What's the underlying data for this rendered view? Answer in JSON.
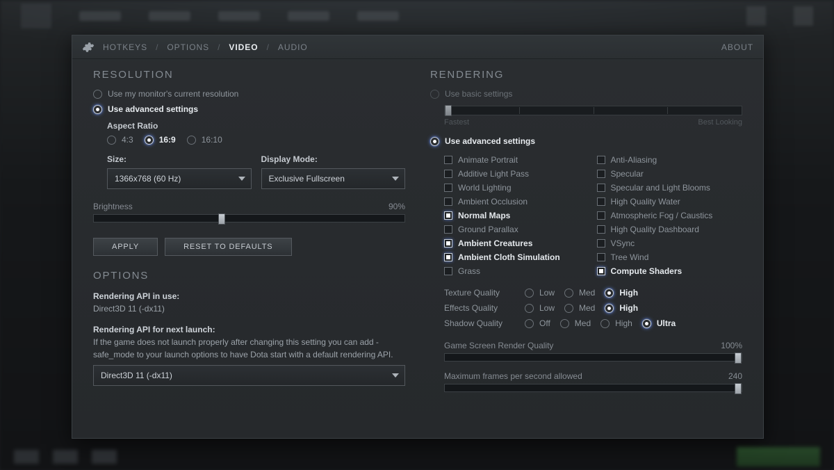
{
  "tabs": {
    "hotkeys": "HOTKEYS",
    "options": "OPTIONS",
    "video": "VIDEO",
    "audio": "AUDIO",
    "about": "ABOUT"
  },
  "resolution": {
    "title": "RESOLUTION",
    "use_monitor": "Use my monitor's current resolution",
    "use_advanced": "Use advanced settings",
    "aspect_label": "Aspect Ratio",
    "aspects": {
      "r43": "4:3",
      "r169": "16:9",
      "r1610": "16:10"
    },
    "size_label": "Size:",
    "size_value": "1366x768 (60 Hz)",
    "mode_label": "Display Mode:",
    "mode_value": "Exclusive Fullscreen",
    "brightness_label": "Brightness",
    "brightness_value": "90%",
    "apply": "APPLY",
    "reset": "RESET TO DEFAULTS"
  },
  "options": {
    "title": "OPTIONS",
    "api_inuse_label": "Rendering API in use:",
    "api_inuse_value": "Direct3D 11 (-dx11)",
    "api_next_label": "Rendering API for next launch:",
    "api_next_help": "If the game does not launch properly after changing this setting you can add -safe_mode to your launch options to have Dota start with a default rendering API.",
    "api_next_value": "Direct3D 11 (-dx11)"
  },
  "rendering": {
    "title": "RENDERING",
    "use_basic": "Use basic settings",
    "basic_fast": "Fastest",
    "basic_best": "Best Looking",
    "use_advanced": "Use advanced settings",
    "checks_left": [
      {
        "key": "animate_portrait",
        "label": "Animate Portrait",
        "on": false
      },
      {
        "key": "additive_light_pass",
        "label": "Additive Light Pass",
        "on": false
      },
      {
        "key": "world_lighting",
        "label": "World Lighting",
        "on": false
      },
      {
        "key": "ambient_occlusion",
        "label": "Ambient Occlusion",
        "on": false
      },
      {
        "key": "normal_maps",
        "label": "Normal Maps",
        "on": true
      },
      {
        "key": "ground_parallax",
        "label": "Ground Parallax",
        "on": false
      },
      {
        "key": "ambient_creatures",
        "label": "Ambient Creatures",
        "on": true
      },
      {
        "key": "ambient_cloth",
        "label": "Ambient Cloth Simulation",
        "on": true
      },
      {
        "key": "grass",
        "label": "Grass",
        "on": false
      }
    ],
    "checks_right": [
      {
        "key": "anti_aliasing",
        "label": "Anti-Aliasing",
        "on": false
      },
      {
        "key": "specular",
        "label": "Specular",
        "on": false
      },
      {
        "key": "specular_blooms",
        "label": "Specular and Light Blooms",
        "on": false
      },
      {
        "key": "hq_water",
        "label": "High Quality Water",
        "on": false
      },
      {
        "key": "fog_caustics",
        "label": "Atmospheric Fog / Caustics",
        "on": false
      },
      {
        "key": "hq_dashboard",
        "label": "High Quality Dashboard",
        "on": false
      },
      {
        "key": "vsync",
        "label": "VSync",
        "on": false
      },
      {
        "key": "tree_wind",
        "label": "Tree Wind",
        "on": false
      },
      {
        "key": "compute_shaders",
        "label": "Compute Shaders",
        "on": true
      }
    ],
    "quality": {
      "texture": {
        "label": "Texture Quality",
        "opts": [
          "Low",
          "Med",
          "High"
        ],
        "sel": "High"
      },
      "effects": {
        "label": "Effects Quality",
        "opts": [
          "Low",
          "Med",
          "High"
        ],
        "sel": "High"
      },
      "shadow": {
        "label": "Shadow Quality",
        "opts": [
          "Off",
          "Med",
          "High",
          "Ultra"
        ],
        "sel": "Ultra"
      }
    },
    "render_quality_label": "Game Screen Render Quality",
    "render_quality_value": "100%",
    "max_fps_label": "Maximum frames per second allowed",
    "max_fps_value": "240"
  }
}
